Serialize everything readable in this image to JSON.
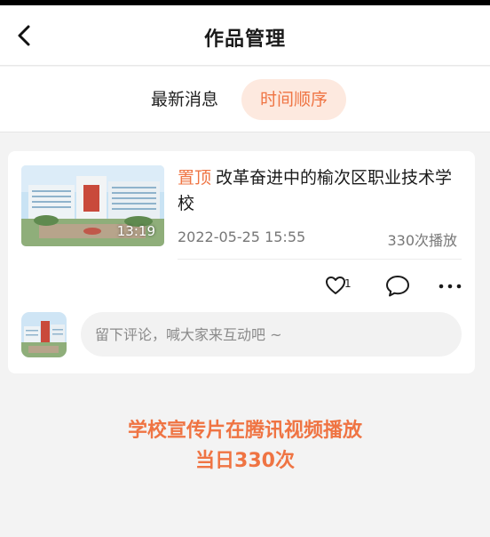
{
  "header": {
    "title": "作品管理",
    "back_icon": "chevron-left-icon"
  },
  "tabs": [
    {
      "label": "最新消息",
      "active": false
    },
    {
      "label": "时间顺序",
      "active": true
    }
  ],
  "video": {
    "pin_label": "置顶",
    "title": "改革奋进中的榆次区职业技术学校",
    "duration": "13:19",
    "date": "2022-05-25 15:55",
    "plays": "330次播放",
    "like_count": "1"
  },
  "comment": {
    "placeholder": "留下评论，喊大家来互动吧 ~"
  },
  "caption": {
    "line1": "学校宣传片在腾讯视频播放",
    "line2": "当日330次"
  },
  "colors": {
    "accent": "#ef7443",
    "accent_bg": "#fde9df",
    "page_bg": "#f3f3f3"
  }
}
